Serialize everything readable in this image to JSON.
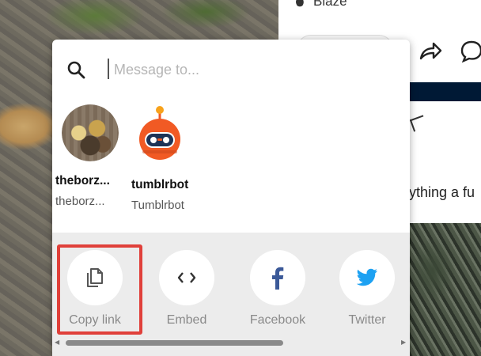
{
  "background": {
    "right_header_label": "Blaze",
    "right_partial_text": "ything a fu"
  },
  "share_popover": {
    "search": {
      "placeholder": "Message to...",
      "value": ""
    },
    "recipients": [
      {
        "name": "theborz...",
        "handle": "theborz...",
        "avatar": "dog-photo-avatar"
      },
      {
        "name": "tumblrbot",
        "handle": "Tumblrbot",
        "avatar": "robot-avatar"
      }
    ],
    "share_options": [
      {
        "label": "Copy link",
        "icon": "copy-link-icon",
        "color": "#5a5a5a",
        "highlighted": true
      },
      {
        "label": "Embed",
        "icon": "embed-code-icon",
        "color": "#333333"
      },
      {
        "label": "Facebook",
        "icon": "facebook-icon",
        "color": "#3b5998"
      },
      {
        "label": "Twitter",
        "icon": "twitter-icon",
        "color": "#1da1f2"
      }
    ],
    "highlight_color": "#e0403a"
  }
}
